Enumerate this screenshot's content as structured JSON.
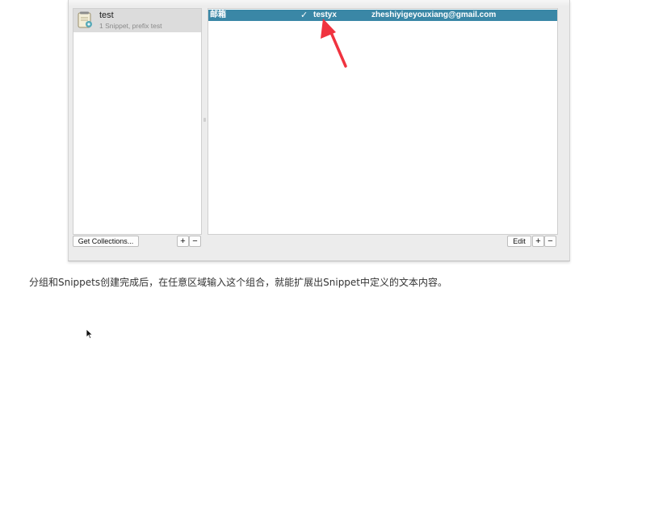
{
  "collections": {
    "items": [
      {
        "name": "test",
        "subtitle": "1 Snippet, prefix test",
        "icon": "notepad-icon"
      }
    ],
    "get_collections_label": "Get Collections...",
    "add_label": "+",
    "remove_label": "−"
  },
  "snippets": {
    "rows": [
      {
        "name": "邮箱",
        "enabled_mark": "✓",
        "abbreviation": "testyx",
        "content": "zheshiyigeyouxiang@gmail.com"
      }
    ],
    "edit_label": "Edit",
    "add_label": "+",
    "remove_label": "−"
  },
  "caption": "分组和Snippets创建完成后，在任意区域输入这个组合，就能扩展出Snippet中定义的文本内容。",
  "colors": {
    "selection": "#3a87a6",
    "annotation_arrow": "#f0333f",
    "collection_selected": "#dcdcdc"
  },
  "icons": [
    "notepad-icon",
    "red-arrow-icon",
    "mouse-cursor-icon"
  ]
}
